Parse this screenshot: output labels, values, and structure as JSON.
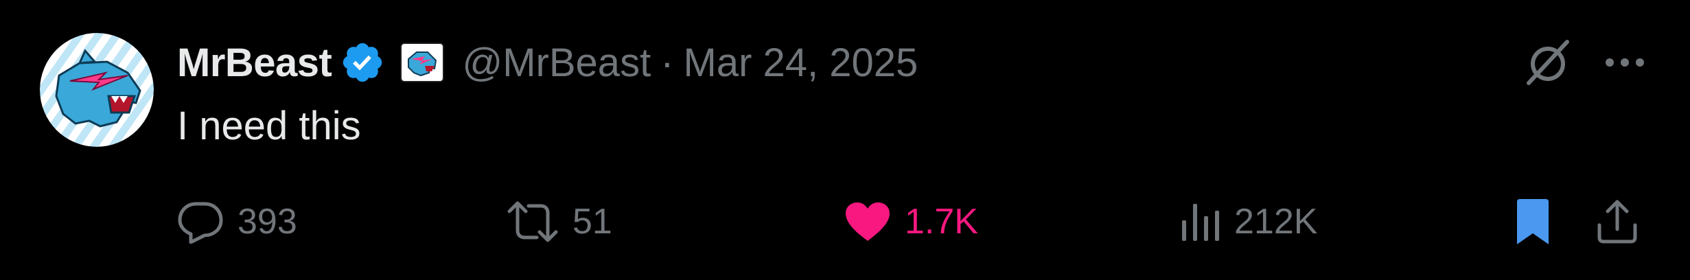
{
  "tweet": {
    "author": {
      "display_name": "MrBeast",
      "handle": "@MrBeast",
      "avatar_icon": "beast-panther-logo",
      "verified_icon": "verified-badge-icon",
      "affiliate_icon": "beast-affiliate-badge-icon"
    },
    "separator": "·",
    "date": "Mar 24, 2025",
    "text": "I need this",
    "stats": {
      "replies": "393",
      "retweets": "51",
      "likes": "1.7K",
      "views": "212K"
    },
    "liked": true,
    "bookmarked": true
  },
  "colors": {
    "background": "#000000",
    "text_primary": "#e7e9ea",
    "text_secondary": "#71767b",
    "verified_blue": "#1d9bf0",
    "like_pink": "#f91880",
    "bookmark_blue": "#4a98ef"
  }
}
